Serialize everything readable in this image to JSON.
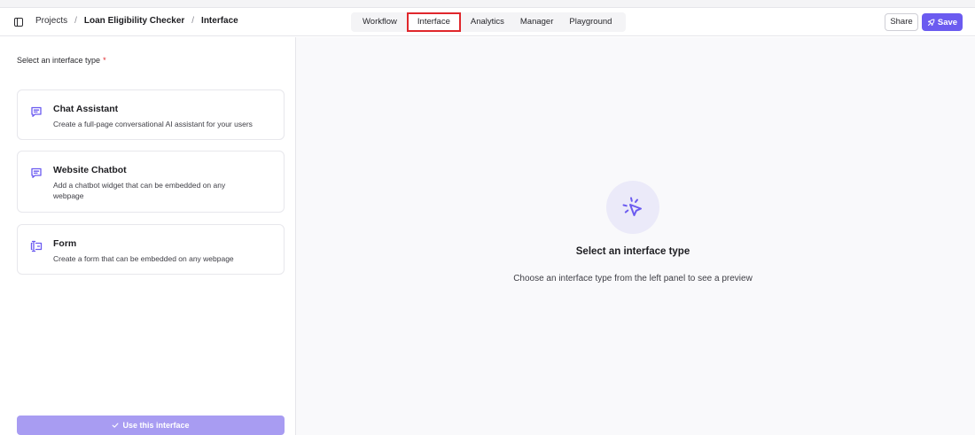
{
  "breadcrumb": {
    "project": "Projects",
    "sep": "/",
    "app": "Loan Eligibility Checker",
    "page": "Interface"
  },
  "tabs": [
    {
      "label": "Workflow",
      "active": false
    },
    {
      "label": "Interface",
      "active": true
    },
    {
      "label": "Analytics",
      "active": false
    },
    {
      "label": "Manager",
      "active": false
    },
    {
      "label": "Playground",
      "active": false
    }
  ],
  "actions": {
    "share_label": "Share",
    "save_label": "Save"
  },
  "left_panel": {
    "select_label": "Select an interface type",
    "required_mark": "*",
    "cards": [
      {
        "title": "Chat Assistant",
        "description": "Create a full-page conversational AI assistant for your users",
        "icon": "chat-icon"
      },
      {
        "title": "Website Chatbot",
        "description": "Add a chatbot widget that can be embedded on any webpage",
        "icon": "chat-icon"
      },
      {
        "title": "Form",
        "description": "Create a form that can be embedded on any webpage",
        "icon": "form-icon"
      }
    ],
    "use_button_label": "Use this interface"
  },
  "preview": {
    "title": "Select an interface type",
    "description": "Choose an interface type from the left panel to see a preview",
    "icon": "cursor-click-icon"
  },
  "colors": {
    "accent": "#6b5bf0",
    "accent_disabled": "#a89cf2",
    "highlight": "#e0272c"
  }
}
